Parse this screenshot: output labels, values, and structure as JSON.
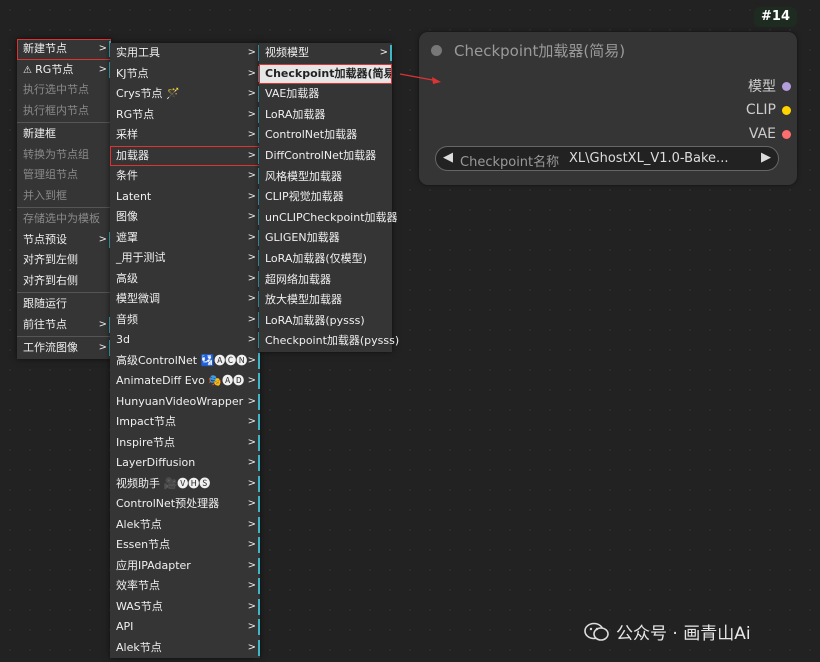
{
  "node_badge": "#14",
  "node": {
    "title": "Checkpoint加载器(简易)",
    "outputs": [
      {
        "label": "模型",
        "color": "#b39ddb"
      },
      {
        "label": "CLIP",
        "color": "#ffd500"
      },
      {
        "label": "VAE",
        "color": "#ff6e6e"
      }
    ],
    "widget": {
      "name": "Checkpoint名称",
      "value": "XL\\GhostXL_V1.0-Bake..."
    }
  },
  "menu1": [
    {
      "label": "新建节点",
      "sub": true,
      "hl": true
    },
    {
      "label": "RG节点",
      "sub": true,
      "icon": true
    },
    {
      "label": "执行选中节点",
      "dis": true
    },
    {
      "label": "执行框内节点",
      "dis": true
    },
    {
      "sep": true
    },
    {
      "label": "新建框"
    },
    {
      "label": "转换为节点组",
      "dis": true
    },
    {
      "label": "管理组节点",
      "dis": true
    },
    {
      "label": "并入到框",
      "dis": true
    },
    {
      "sep": true
    },
    {
      "label": "存储选中为模板",
      "dis": true
    },
    {
      "label": "节点预设",
      "sub": true
    },
    {
      "label": "对齐到左侧"
    },
    {
      "label": "对齐到右侧"
    },
    {
      "sep": true
    },
    {
      "label": "跟随运行"
    },
    {
      "label": "前往节点",
      "sub": true
    },
    {
      "sep": true
    },
    {
      "label": "工作流图像",
      "sub": true
    }
  ],
  "menu2": [
    {
      "label": "实用工具"
    },
    {
      "label": "KJ节点"
    },
    {
      "label": "Crys节点 🪄"
    },
    {
      "label": "RG节点"
    },
    {
      "label": "采样"
    },
    {
      "label": "加载器",
      "hl": true
    },
    {
      "label": "条件"
    },
    {
      "label": "Latent"
    },
    {
      "label": "图像"
    },
    {
      "label": "遮罩"
    },
    {
      "label": "_用于测试"
    },
    {
      "label": "高级"
    },
    {
      "label": "模型微调"
    },
    {
      "label": "音频"
    },
    {
      "label": "3d"
    },
    {
      "label": "高级ControlNet 🛂🅐🅒🅝"
    },
    {
      "label": "AnimateDiff Evo 🎭🅐🅓"
    },
    {
      "label": "HunyuanVideoWrapper"
    },
    {
      "label": "Impact节点"
    },
    {
      "label": "Inspire节点"
    },
    {
      "label": "LayerDiffusion"
    },
    {
      "label": "视频助手 🎥🅥🅗🅢"
    },
    {
      "label": "ControlNet预处理器"
    },
    {
      "label": "Alek节点"
    },
    {
      "label": "Essen节点"
    },
    {
      "label": "应用IPAdapter"
    },
    {
      "label": "效率节点"
    },
    {
      "label": "WAS节点"
    },
    {
      "label": "API"
    },
    {
      "label": "Alek节点"
    }
  ],
  "menu3": [
    {
      "label": "视频模型",
      "sub": true
    },
    {
      "label": "Checkpoint加载器(简易)",
      "hl": true
    },
    {
      "label": "VAE加载器"
    },
    {
      "label": "LoRA加载器"
    },
    {
      "label": "ControlNet加载器"
    },
    {
      "label": "DiffControlNet加载器"
    },
    {
      "label": "风格模型加载器"
    },
    {
      "label": "CLIP视觉加载器"
    },
    {
      "label": "unCLIPCheckpoint加载器"
    },
    {
      "label": "GLIGEN加载器"
    },
    {
      "label": "LoRA加载器(仅模型)"
    },
    {
      "label": "超网络加载器"
    },
    {
      "label": "放大模型加载器"
    },
    {
      "label": "LoRA加载器(pysss)"
    },
    {
      "label": "Checkpoint加载器(pysss)"
    }
  ],
  "watermark": "公众号 · 画青山Ai"
}
